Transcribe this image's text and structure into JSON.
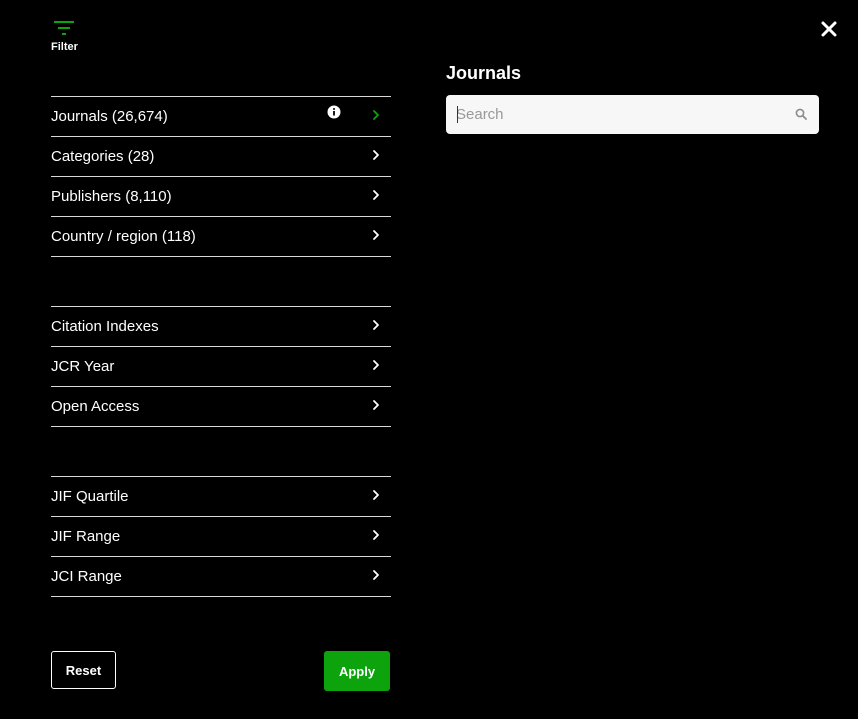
{
  "header": {
    "filter_label": "Filter",
    "filter_icon": "filter-icon",
    "close_icon": "close-icon"
  },
  "colors": {
    "background": "#000000",
    "accent": "#0da30d",
    "divider": "#d9d9d9",
    "search_bg": "#f7f7f7"
  },
  "filter_groups": [
    {
      "items": [
        {
          "label": "Journals (26,674)",
          "active": true,
          "info": true
        },
        {
          "label": "Categories (28)"
        },
        {
          "label": "Publishers (8,110)"
        },
        {
          "label": "Country / region (118)"
        }
      ]
    },
    {
      "items": [
        {
          "label": "Citation Indexes"
        },
        {
          "label": "JCR Year"
        },
        {
          "label": "Open Access"
        }
      ]
    },
    {
      "items": [
        {
          "label": "JIF Quartile"
        },
        {
          "label": "JIF Range"
        },
        {
          "label": "JCI Range"
        }
      ]
    }
  ],
  "actions": {
    "reset_label": "Reset",
    "apply_label": "Apply"
  },
  "panel": {
    "title": "Journals",
    "search": {
      "placeholder": "Search",
      "value": ""
    }
  }
}
